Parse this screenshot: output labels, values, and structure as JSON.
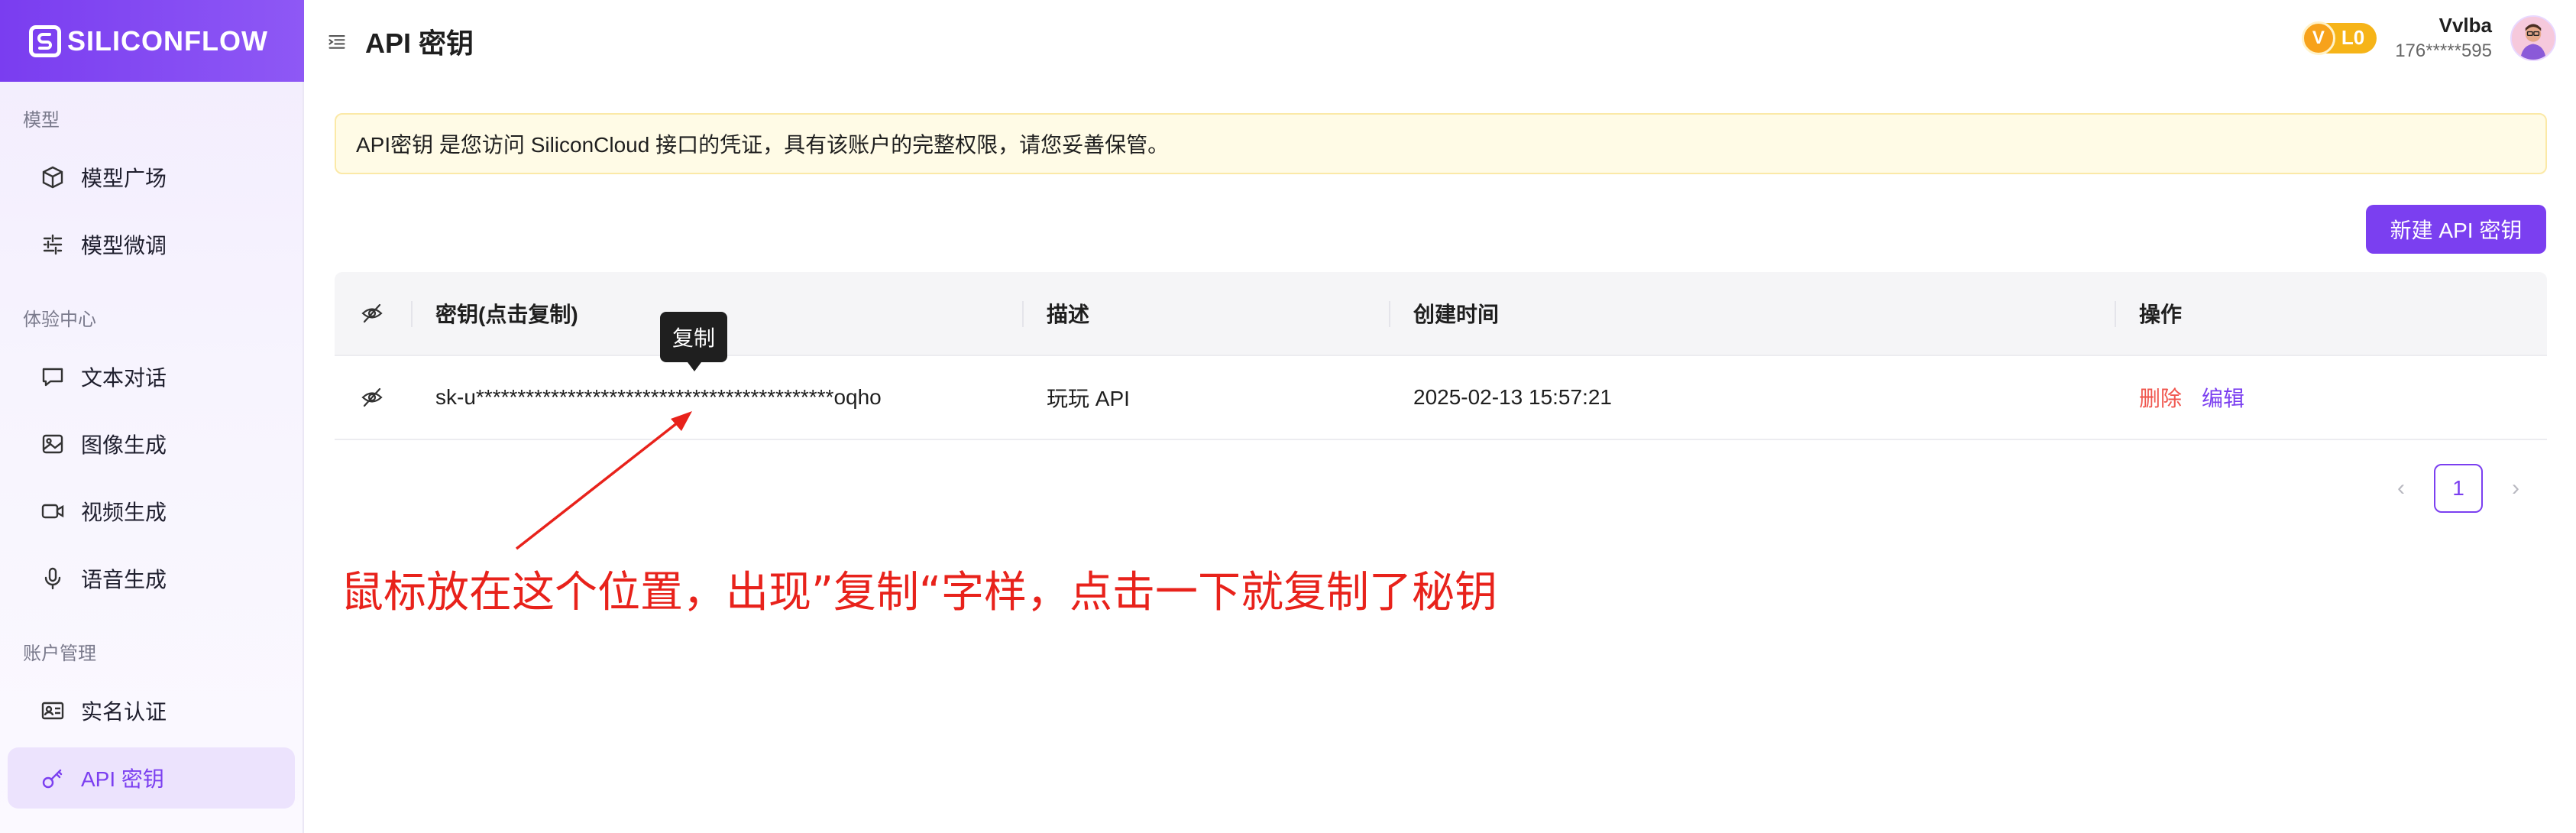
{
  "brand": {
    "name": "SILICONFLOW",
    "accent": "#7b3ff0"
  },
  "sidebar": {
    "sections": [
      {
        "title": "模型",
        "items": [
          {
            "label": "模型广场",
            "icon": "cube-icon"
          },
          {
            "label": "模型微调",
            "icon": "sliders-icon"
          }
        ]
      },
      {
        "title": "体验中心",
        "items": [
          {
            "label": "文本对话",
            "icon": "chat-icon"
          },
          {
            "label": "图像生成",
            "icon": "image-icon"
          },
          {
            "label": "视频生成",
            "icon": "video-icon"
          },
          {
            "label": "语音生成",
            "icon": "mic-icon"
          }
        ]
      },
      {
        "title": "账户管理",
        "items": [
          {
            "label": "实名认证",
            "icon": "id-card-icon"
          },
          {
            "label": "API 密钥",
            "icon": "key-icon",
            "active": true
          }
        ]
      }
    ]
  },
  "header": {
    "title": "API 密钥",
    "level": "L0",
    "level_mark": "V",
    "user_name": "Vvlba",
    "user_phone": "176*****595"
  },
  "notice": "API密钥 是您访问 SiliconCloud 接口的凭证，具有该账户的完整权限，请您妥善保管。",
  "new_key_button": "新建 API 密钥",
  "table": {
    "headers": [
      "密钥(点击复制)",
      "描述",
      "创建时间",
      "操作"
    ],
    "rows": [
      {
        "key": "sk-u*******************************************oqho",
        "desc": "玩玩 API",
        "created": "2025-02-13 15:57:21",
        "actions": [
          "删除",
          "编辑"
        ]
      }
    ]
  },
  "tooltip": "复制",
  "pagination": {
    "current": "1",
    "prev": "‹",
    "next": "›"
  },
  "annotation": "鼠标放在这个位置，出现”复制“字样，点击一下就复制了秘钥"
}
